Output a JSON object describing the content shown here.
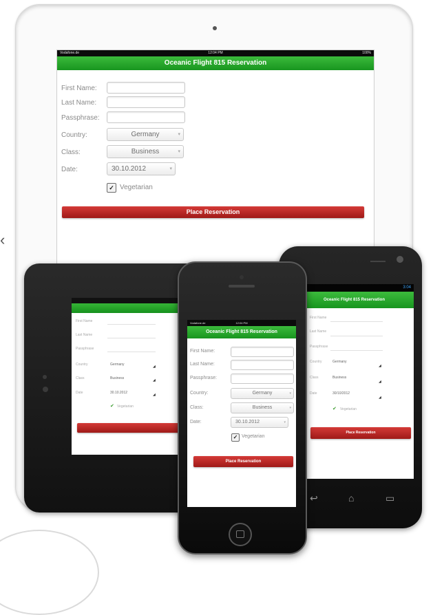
{
  "app": {
    "title": "Oceanic Flight 815 Reservation",
    "status_carrier": "Vodafone.de",
    "status_time": "12:04 PM",
    "status_battery": "100%"
  },
  "form": {
    "first_name_label": "First Name:",
    "last_name_label": "Last Name:",
    "passphrase_label": "Passphrase:",
    "country_label": "Country:",
    "class_label": "Class:",
    "date_label": "Date:",
    "country_value": "Germany",
    "class_value": "Business",
    "date_value": "30.10.2012",
    "vegetarian_label": "Vegetarian",
    "submit_label": "Place Reservation"
  },
  "tablet_form": {
    "first_name_label": "First Name",
    "last_name_label": "Last Name",
    "passphrase_label": "Passphrase",
    "country_label": "Country",
    "class_label": "Class",
    "date_label": "Date",
    "country_value": "Germany",
    "class_value": "Business",
    "date_value": "30.10.2012",
    "vegetarian_label": "Vegetarian",
    "check_mark": "✔"
  },
  "android": {
    "status_time": "3:04",
    "date_value": "30/10/2012"
  },
  "colors": {
    "titlebar_green": "#22a52a",
    "button_red": "#b42825"
  },
  "icons": {
    "checkmark": "check-icon",
    "dropdown": "chevron-down-icon"
  }
}
